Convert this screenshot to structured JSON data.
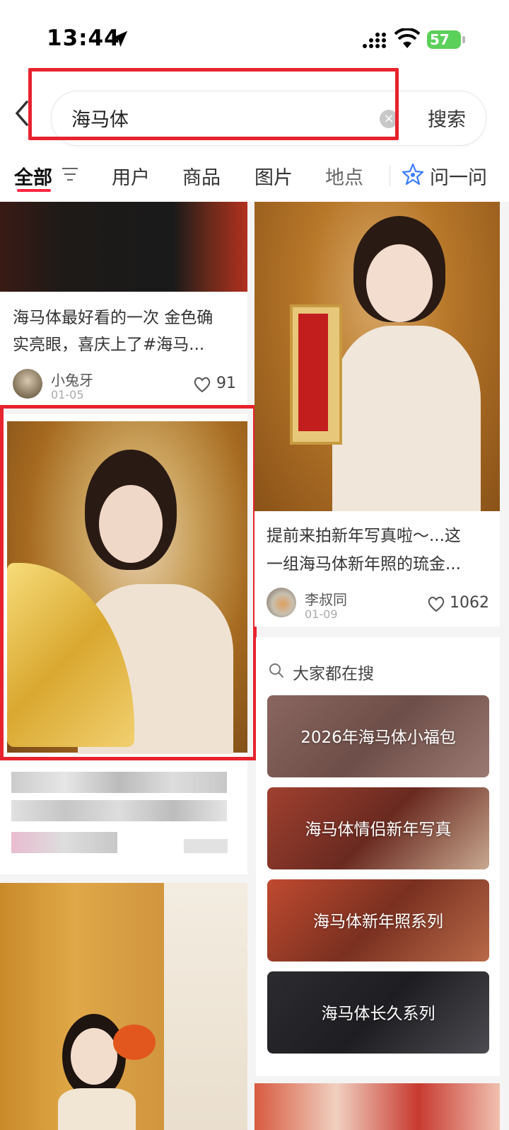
{
  "status_bar": {
    "time": "13:44",
    "battery": "57"
  },
  "search": {
    "query": "海马体",
    "clear_icon": "×",
    "button_label": "搜索"
  },
  "tabs": [
    {
      "label": "全部",
      "active": true
    },
    {
      "label": "用户"
    },
    {
      "label": "商品"
    },
    {
      "label": "图片"
    },
    {
      "label": "地点"
    },
    {
      "label": "问一问"
    }
  ],
  "feed": {
    "left": [
      {
        "title_line1": "海马体最好看的一次 金色确",
        "title_line2": "实亮眼，喜庆上了#海马...",
        "author": "小兔牙",
        "date": "01-05",
        "likes": "91"
      }
    ],
    "right": [
      {
        "title_line1": "提前来拍新年写真啦～...这",
        "title_line2": "一组海马体新年照的琉金...",
        "author": "李叔同",
        "date": "01-09",
        "likes": "1062"
      }
    ]
  },
  "suggestions": {
    "title": "大家都在搜",
    "items": [
      {
        "label": "2026年海马体小福包",
        "color": "#7a5550"
      },
      {
        "label": "海马体情侣新年写真",
        "color": "#8a3a2a"
      },
      {
        "label": "海马体新年照系列",
        "color": "#9a4630"
      },
      {
        "label": "海马体长久系列",
        "color": "#2a2a2e"
      }
    ]
  },
  "colors": {
    "accent": "#ff2442",
    "highlight": "#e7232e"
  }
}
